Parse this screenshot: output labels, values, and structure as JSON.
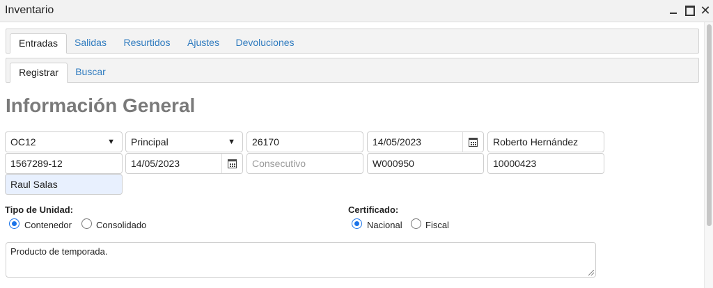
{
  "window": {
    "title": "Inventario",
    "close_glyph": "✕"
  },
  "tabs_main": [
    {
      "label": "Entradas",
      "active": true
    },
    {
      "label": "Salidas",
      "active": false
    },
    {
      "label": "Resurtidos",
      "active": false
    },
    {
      "label": "Ajustes",
      "active": false
    },
    {
      "label": "Devoluciones",
      "active": false
    }
  ],
  "tabs_sub": [
    {
      "label": "Registrar",
      "active": true
    },
    {
      "label": "Buscar",
      "active": false
    }
  ],
  "section": {
    "title": "Información General"
  },
  "fields": {
    "orden_select": "OC12",
    "almacen_select": "Principal",
    "numero": "26170",
    "fecha1": "14/05/2023",
    "responsable": "Roberto Hernández",
    "referencia": "1567289-12",
    "fecha2": "14/05/2023",
    "consecutivo_placeholder": "Consecutivo",
    "codigo": "W000950",
    "folio": "10000423",
    "usuario": "Raul Salas"
  },
  "tipo_unidad": {
    "label": "Tipo de Unidad:",
    "options": [
      "Contenedor",
      "Consolidado"
    ],
    "selected": "Contenedor"
  },
  "certificado": {
    "label": "Certificado:",
    "options": [
      "Nacional",
      "Fiscal"
    ],
    "selected": "Nacional"
  },
  "notes": {
    "value": "Producto de temporada."
  },
  "icons": {
    "dropdown": "chevron-down-icon",
    "calendar": "calendar-icon",
    "minimize": "minimize-icon",
    "maximize": "maximize-icon",
    "close": "close-icon"
  },
  "colors": {
    "link": "#2f7bbf",
    "radio_selected": "#1a73e8",
    "highlight_field": "#e8f0fe",
    "section_title": "#7a7a7a"
  }
}
